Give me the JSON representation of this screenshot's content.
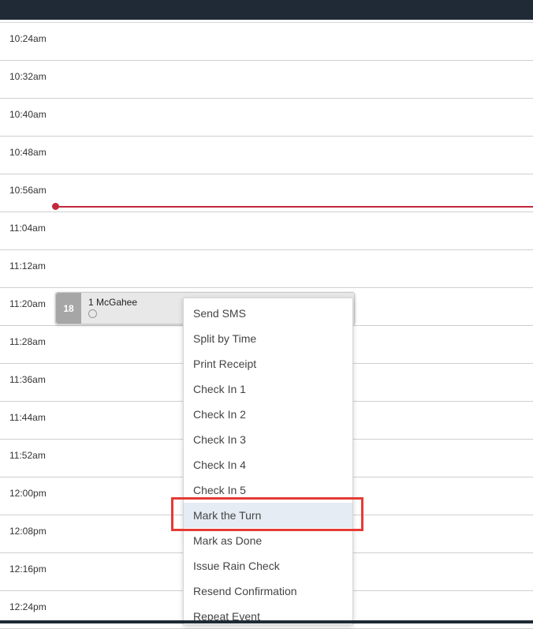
{
  "time_slots": [
    "10:24am",
    "10:32am",
    "10:40am",
    "10:48am",
    "10:56am",
    "11:04am",
    "11:12am",
    "11:20am",
    "11:28am",
    "11:36am",
    "11:44am",
    "11:52am",
    "12:00pm",
    "12:08pm",
    "12:16pm",
    "12:24pm"
  ],
  "appointment": {
    "number": "18",
    "title": "1  McGahee"
  },
  "context_menu": {
    "items": [
      "Send SMS",
      "Split by Time",
      "Print Receipt",
      "Check In 1",
      "Check In 2",
      "Check In 3",
      "Check In 4",
      "Check In 5",
      "Mark the Turn",
      "Mark as Done",
      "Issue Rain Check",
      "Resend Confirmation",
      "Repeat Event"
    ],
    "highlighted": "Mark the Turn"
  },
  "colors": {
    "topbar": "#1f2a36",
    "now_line": "#c0283b",
    "annotation": "#e53b35",
    "menu_hover": "#e5ecf4"
  }
}
